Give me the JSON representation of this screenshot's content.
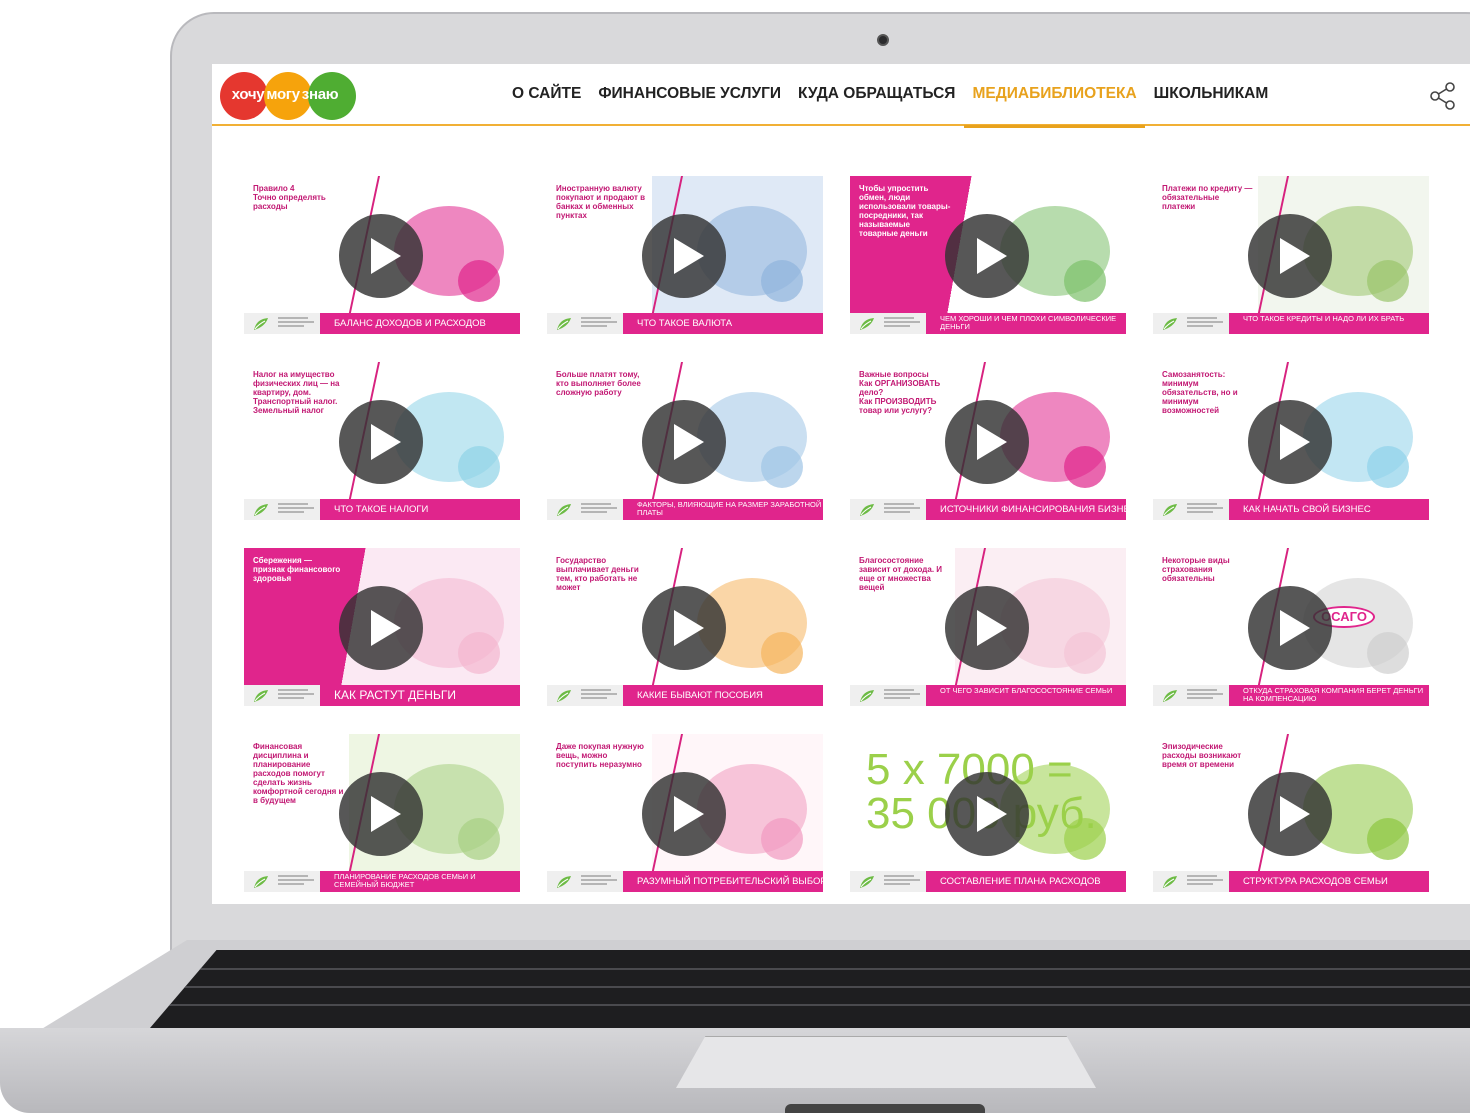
{
  "site": {
    "logo_words": [
      "хочу",
      "могу",
      "знаю"
    ],
    "logo_colors": [
      "#e5372f",
      "#f6a30c",
      "#4fad32"
    ],
    "nav": [
      {
        "label": "О САЙТЕ",
        "active": false
      },
      {
        "label": "ФИНАНСОВЫЕ УСЛУГИ",
        "active": false
      },
      {
        "label": "КУДА ОБРАЩАТЬСЯ",
        "active": false
      },
      {
        "label": "МЕДИАБИБЛИОТЕКА",
        "active": true
      },
      {
        "label": "ШКОЛЬНИКАМ",
        "active": false
      }
    ],
    "share_icon": "share-icon"
  },
  "colors": {
    "accent": "#e8a21d",
    "magenta": "#e0258c",
    "text": "#222222"
  },
  "videos": [
    {
      "caption": "Правило 4\nТочно определять расходы",
      "title": "БАЛАНС ДОХОДОВ И РАСХОДОВ"
    },
    {
      "caption": "Иностранную валюту покупают и продают в банках и обменных пунктах",
      "title": "ЧТО ТАКОЕ ВАЛЮТА"
    },
    {
      "caption": "Чтобы упростить обмен, люди использовали товары-посредники, так называемые товарные деньги",
      "title": "ЧЕМ ХОРОШИ И ЧЕМ ПЛОХИ СИМВОЛИЧЕСКИЕ ДЕНЬГИ"
    },
    {
      "caption": "Платежи по кредиту — обязательные платежи",
      "title": "ЧТО ТАКОЕ КРЕДИТЫ И НАДО ЛИ ИХ БРАТЬ"
    },
    {
      "caption": "Налог на имущество физических лиц — на квартиру, дом. Транспортный налог. Земельный налог",
      "title": "ЧТО ТАКОЕ НАЛОГИ"
    },
    {
      "caption": "Больше платят тому, кто выполняет более сложную работу",
      "title": "ФАКТОРЫ, ВЛИЯЮЩИЕ НА РАЗМЕР ЗАРАБОТНОЙ ПЛАТЫ"
    },
    {
      "caption": "Важные вопросы\nКак ОРГАНИЗОВАТЬ дело?\nКак ПРОИЗВОДИТЬ товар или услугу?",
      "title": "ИСТОЧНИКИ ФИНАНСИРОВАНИЯ БИЗНЕСА"
    },
    {
      "caption": "Самозанятость: минимум обязательств, но и минимум возможностей",
      "title": "КАК НАЧАТЬ СВОЙ БИЗНЕС"
    },
    {
      "caption": "Сбережения — признак финансового здоровья",
      "title": "КАК РАСТУТ ДЕНЬГИ"
    },
    {
      "caption": "Государство выплачивает деньги тем, кто работать не может",
      "title": "КАКИЕ БЫВАЮТ ПОСОБИЯ"
    },
    {
      "caption": "Благосостояние зависит от дохода. И еще от множества вещей",
      "title": "ОТ ЧЕГО ЗАВИСИТ БЛАГОСОСТОЯНИЕ СЕМЬИ"
    },
    {
      "caption": "Некоторые виды страхования обязательны",
      "title": "ОТКУДА СТРАХОВАЯ КОМПАНИЯ БЕРЕТ ДЕНЬГИ НА КОМПЕНСАЦИЮ",
      "badge": "ОСАГО"
    },
    {
      "caption": "Финансовая дисциплина и планирование расходов помогут сделать жизнь комфортной сегодня и в будущем",
      "title": "ПЛАНИРОВАНИЕ РАСХОДОВ СЕМЬИ И СЕМЕЙНЫЙ БЮДЖЕТ"
    },
    {
      "caption": "Даже покупая нужную вещь, можно поступить неразумно",
      "title": "РАЗУМНЫЙ ПОТРЕБИТЕЛЬСКИЙ ВЫБОР"
    },
    {
      "caption": "5 x 7000 =\n35 000 руб.",
      "title": "СОСТАВЛЕНИЕ ПЛАНА РАСХОДОВ"
    },
    {
      "caption": "Эпизодические расходы возникают время от времени",
      "title": "СТРУКТУРА РАСХОДОВ СЕМЬИ"
    }
  ]
}
